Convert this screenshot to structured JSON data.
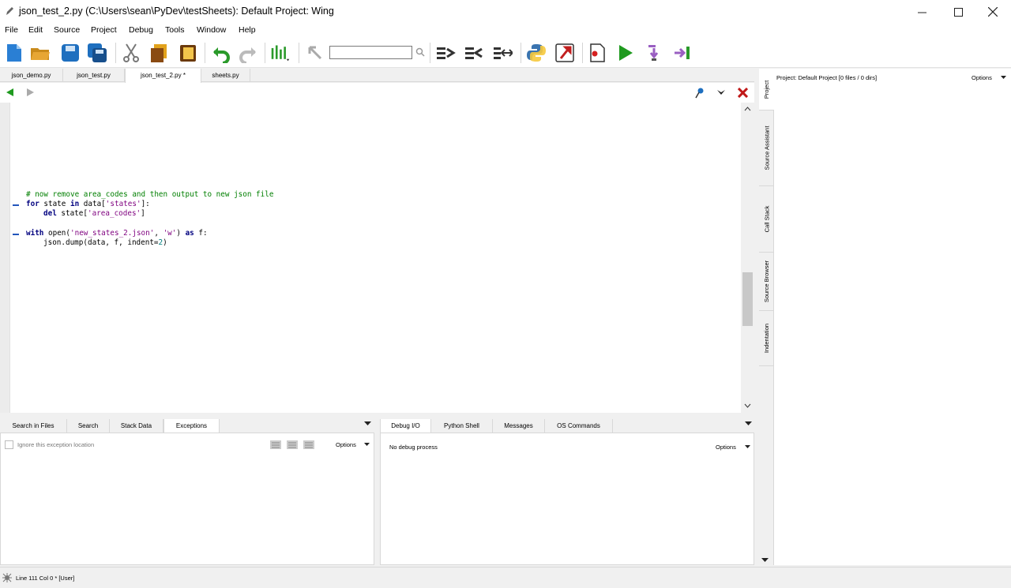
{
  "window": {
    "title": "json_test_2.py (C:\\Users\\sean\\PyDev\\testSheets): Default Project: Wing"
  },
  "menu": {
    "items": [
      "File",
      "Edit",
      "Source",
      "Project",
      "Debug",
      "Tools",
      "Window",
      "Help"
    ]
  },
  "toolbar": {
    "search_value": ""
  },
  "editor_tabs": [
    "json_demo.py",
    "json_test.py",
    "json_test_2.py *",
    "sheets.py"
  ],
  "code": {
    "line1_comment": "# now remove area_codes and then output to new json file",
    "line2_kw_for": "for",
    "line2_a": " state ",
    "line2_kw_in": "in",
    "line2_b": " data[",
    "line2_str": "'states'",
    "line2_c": "]:",
    "line3_kw_del": "del",
    "line3_a": " state[",
    "line3_str": "'area_codes'",
    "line3_b": "]",
    "line5_kw_with": "with",
    "line5_a": " ",
    "line5_open": "open",
    "line5_b": "(",
    "line5_str1": "'new_states_2.json'",
    "line5_c": ", ",
    "line5_str2": "'w'",
    "line5_d": ") ",
    "line5_kw_as": "as",
    "line5_e": " f:",
    "line6_a": "json.dump(data, f, indent=",
    "line6_num": "2",
    "line6_b": ")"
  },
  "left_panel": {
    "tabs": [
      "Search in Files",
      "Search",
      "Stack Data",
      "Exceptions"
    ],
    "ignore_label": "Ignore this exception location",
    "options_label": "Options"
  },
  "right_panel": {
    "tabs": [
      "Debug I/O",
      "Python Shell",
      "Messages",
      "OS Commands"
    ],
    "status_text": "No debug process",
    "options_label": "Options"
  },
  "side_panel": {
    "vertical_tabs": [
      "Project",
      "Source Assistant",
      "Call Stack",
      "Source Browser",
      "Indentation"
    ],
    "project_text": "Project: Default Project [0 files / 0 dirs]",
    "options_label": "Options"
  },
  "status": {
    "text": "Line 111 Col 0 * [User]"
  },
  "colors": {
    "keyword": "#00007f",
    "string": "#7f007f",
    "comment": "#007f00",
    "number": "#007f7f"
  }
}
